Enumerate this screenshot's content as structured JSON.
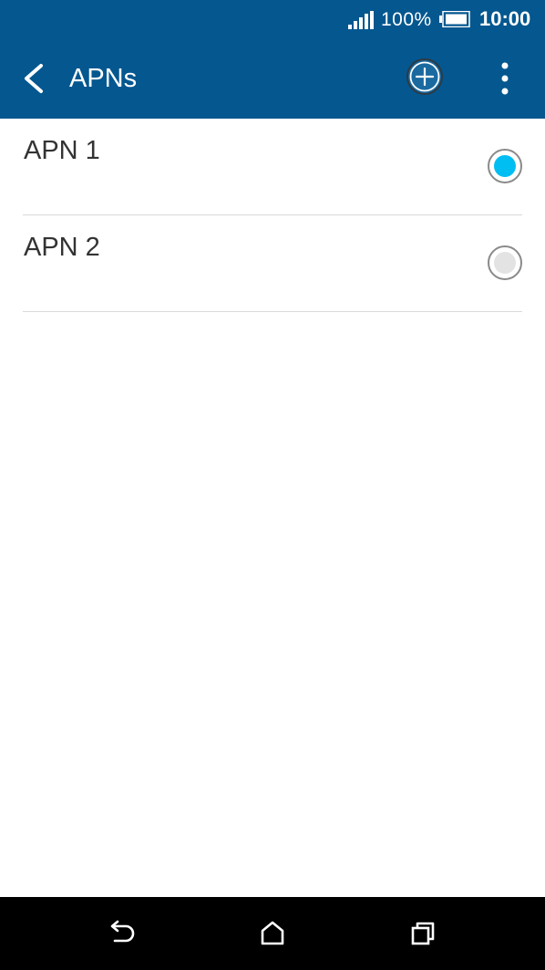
{
  "status_bar": {
    "battery_percent": "100%",
    "time": "10:00",
    "signal_icon": "signal-icon",
    "battery_icon": "battery-icon"
  },
  "toolbar": {
    "title": "APNs",
    "back_icon": "back-arrow-icon",
    "add_icon": "add-circle-icon",
    "menu_icon": "more-vertical-icon",
    "background_color": "#04578f"
  },
  "apns": [
    {
      "name": "APN 1",
      "selected": true
    },
    {
      "name": "APN 2",
      "selected": false
    }
  ],
  "radio_colors": {
    "selected": "#00bdf2",
    "unselected": "#e3e3e3"
  },
  "nav_bar": {
    "back_icon": "nav-back-icon",
    "home_icon": "nav-home-icon",
    "recents_icon": "nav-recents-icon"
  }
}
